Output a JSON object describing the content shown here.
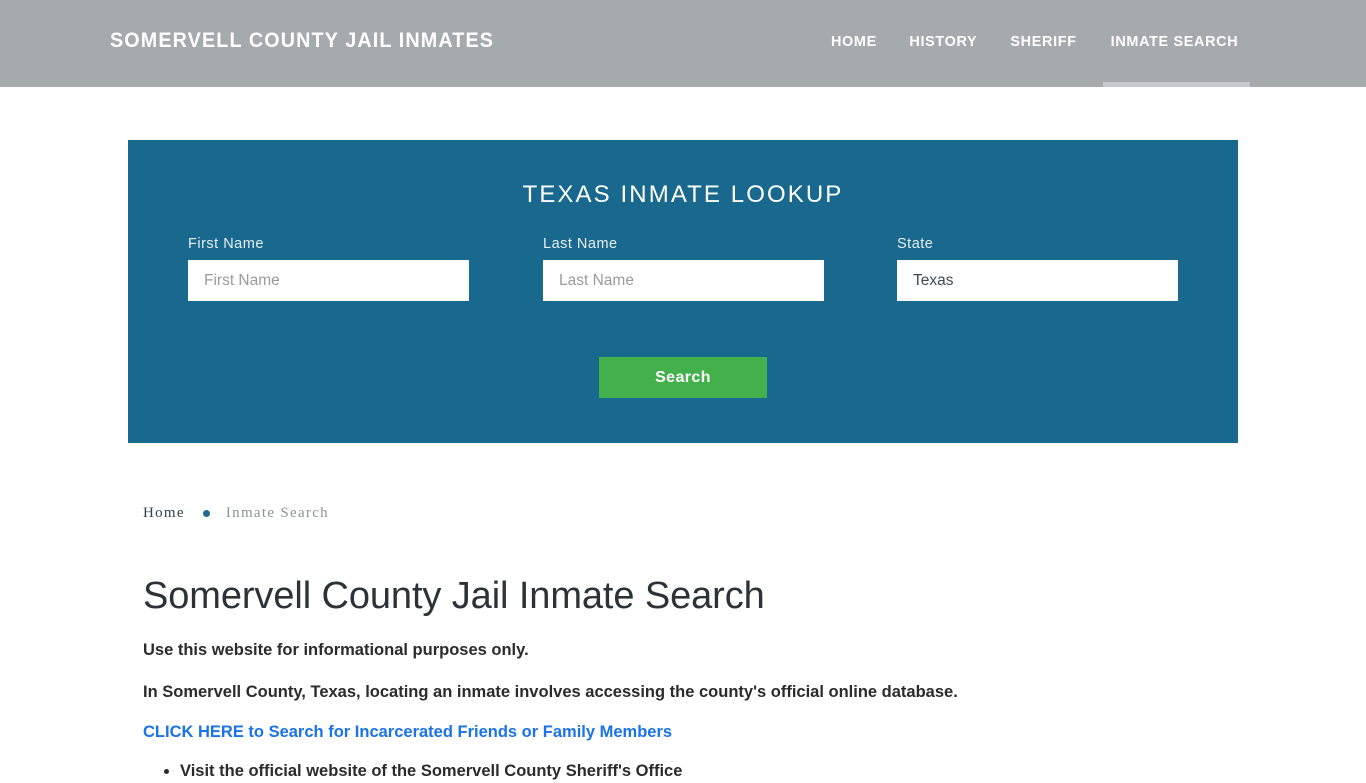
{
  "header": {
    "brand": "Somervell County Jail Inmates",
    "nav": [
      {
        "label": "Home",
        "active": false
      },
      {
        "label": "History",
        "active": false
      },
      {
        "label": "Sheriff",
        "active": false
      },
      {
        "label": "Inmate Search",
        "active": true
      }
    ]
  },
  "lookup": {
    "title": "Texas Inmate Lookup",
    "panel_color": "#19688d",
    "fields": {
      "first_name": {
        "label": "First Name",
        "value": "",
        "placeholder": "First Name"
      },
      "last_name": {
        "label": "Last Name",
        "value": "",
        "placeholder": "Last Name"
      },
      "state": {
        "label": "State",
        "value": "Texas",
        "placeholder": "State"
      }
    },
    "search_button": {
      "label": "Search",
      "color": "#43b14b"
    }
  },
  "breadcrumb": {
    "home": "Home",
    "separator": "bullet-dot-icon",
    "current": "Inmate Search"
  },
  "main": {
    "title": "Somervell County Jail Inmate Search",
    "paragraph_1": "Use this website for informational purposes only.",
    "paragraph_2": "In Somervell County, Texas, locating an inmate involves accessing the county's official online database.",
    "cta_link": "CLICK HERE to Search for Incarcerated Friends or Family Members",
    "cta_link_color": "#1a73e8",
    "list_items": [
      "Visit the official website of the Somervell County Sheriff's Office"
    ]
  }
}
